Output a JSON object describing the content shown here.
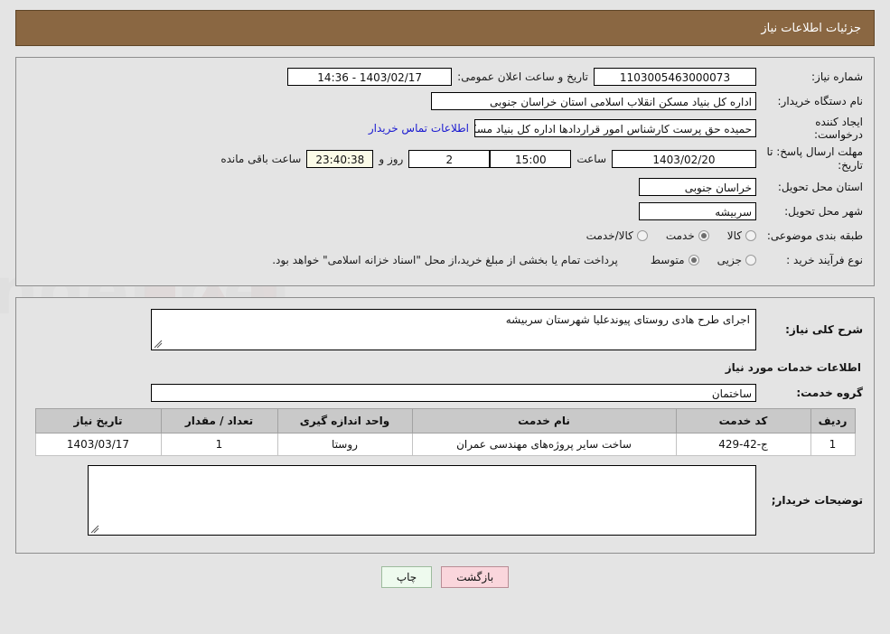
{
  "header": {
    "title": "جزئیات اطلاعات نیاز"
  },
  "form": {
    "need_no_label": "شماره نیاز:",
    "need_no_value": "1103005463000073",
    "announce_label": "تاریخ و ساعت اعلان عمومی:",
    "announce_value": "1403/02/17 - 14:36",
    "buyer_org_label": "نام دستگاه خریدار:",
    "buyer_org_value": "اداره کل بنیاد مسکن انقلاب اسلامی استان خراسان جنوبی",
    "creator_label": "ایجاد کننده درخواست:",
    "creator_value": "حمیده حق پرست کارشناس امور قراردادها اداره کل بنیاد مسکن انقلاب اسلامی",
    "contact_link": "اطلاعات تماس خریدار",
    "deadline_label": "مهلت ارسال پاسخ: تا تاریخ:",
    "deadline_value": "1403/02/20",
    "hour_label": "ساعت",
    "hour_value": "15:00",
    "days_value": "2",
    "days_sep": "روز و",
    "timer_value": "23:40:38",
    "remaining_text": "ساعت باقی مانده",
    "province_label": "استان محل تحویل:",
    "province_value": "خراسان جنوبی",
    "city_label": "شهر محل تحویل:",
    "city_value": "سربیشه",
    "category_label": "طبقه بندی موضوعی:",
    "category_options": [
      {
        "label": "کالا",
        "selected": false
      },
      {
        "label": "خدمت",
        "selected": true
      },
      {
        "label": "کالا/خدمت",
        "selected": false
      }
    ],
    "process_label": "نوع فرآیند خرید :",
    "process_options": [
      {
        "label": "جزیی",
        "selected": false
      },
      {
        "label": "متوسط",
        "selected": true
      }
    ],
    "process_note": "پرداخت تمام یا بخشی از مبلغ خرید،از محل \"اسناد خزانه اسلامی\" خواهد بود."
  },
  "details": {
    "desc_label": "شرح کلی نیاز:",
    "desc_value": "اجرای طرح هادی روستای پیوندعلیا شهرستان سربیشه",
    "services_heading": "اطلاعات خدمات مورد نیاز",
    "group_label": "گروه خدمت:",
    "group_value": "ساختمان",
    "buyer_notes_label": "توضیحات خریدار;",
    "buyer_notes_value": ""
  },
  "table": {
    "columns": [
      "ردیف",
      "کد خدمت",
      "نام خدمت",
      "واحد اندازه گیری",
      "تعداد / مقدار",
      "تاریخ نیاز"
    ],
    "rows": [
      {
        "index": "1",
        "code": "ج-42-429",
        "name": "ساخت سایر پروژه‌های مهندسی عمران",
        "unit": "روستا",
        "qty": "1",
        "date": "1403/03/17"
      }
    ]
  },
  "buttons": {
    "back": "بازگشت",
    "print": "چاپ"
  },
  "colors": {
    "header_bg": "#8a6742",
    "page_bg": "#e4e4e4",
    "link": "#1919d0",
    "timer_bg": "#fbfbe7",
    "btn_back_bg": "#fad6dc",
    "btn_print_bg": "#eefaee",
    "table_header_bg": "#c9c9c9"
  }
}
